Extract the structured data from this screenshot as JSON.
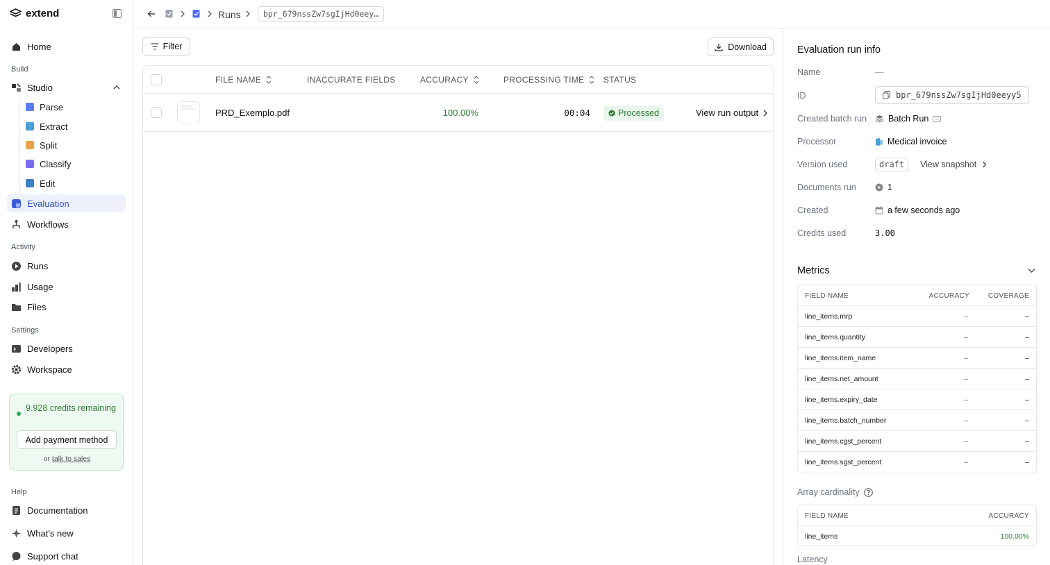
{
  "app": {
    "name": "extend"
  },
  "sidebar": {
    "home": "Home",
    "build_label": "Build",
    "studio": "Studio",
    "studio_items": [
      "Parse",
      "Extract",
      "Split",
      "Classify",
      "Edit"
    ],
    "evaluation": "Evaluation",
    "workflows": "Workflows",
    "activity_label": "Activity",
    "runs": "Runs",
    "usage": "Usage",
    "files": "Files",
    "settings_label": "Settings",
    "developers": "Developers",
    "workspace": "Workspace",
    "credits": "9.928 credits remaining",
    "add_payment": "Add payment method",
    "or": "or",
    "talk_to_sales": "talk to sales",
    "help_label": "Help",
    "documentation": "Documentation",
    "whats_new": "What's new",
    "support_chat": "Support chat"
  },
  "breadcrumb": {
    "runs": "Runs",
    "run_id": "bpr_679nssZw7sgIjHd0eey…"
  },
  "toolbar": {
    "filter": "Filter",
    "download": "Download"
  },
  "table": {
    "headers": {
      "file_name": "FILE NAME",
      "inaccurate_fields": "INACCURATE FIELDS",
      "accuracy": "ACCURACY",
      "processing_time": "PROCESSING TIME",
      "status": "STATUS"
    },
    "rows": [
      {
        "file_name": "PRD_Exemplo.pdf",
        "accuracy": "100.00%",
        "processing_time": "00:04",
        "status": "Processed",
        "action": "View run output"
      }
    ]
  },
  "run_info": {
    "title": "Evaluation run info",
    "labels": {
      "name": "Name",
      "id": "ID",
      "created_batch_run": "Created batch run",
      "processor": "Processor",
      "version_used": "Version used",
      "documents_run": "Documents run",
      "created": "Created",
      "credits_used": "Credits used"
    },
    "values": {
      "name": "—",
      "id": "bpr_679nssZw7sgIjHd0eeyy5",
      "created_batch_run": "Batch Run",
      "processor": "Medical invoice",
      "version": "draft",
      "view_snapshot": "View snapshot",
      "documents_run": "1",
      "created": "a few seconds ago",
      "credits_used": "3.00"
    }
  },
  "metrics": {
    "title": "Metrics",
    "headers": {
      "field_name": "FIELD NAME",
      "accuracy": "ACCURACY",
      "coverage": "COVERAGE"
    },
    "rows": [
      {
        "field": "line_items.mrp",
        "accuracy": "–",
        "coverage": "–"
      },
      {
        "field": "line_items.quantity",
        "accuracy": "–",
        "coverage": "–"
      },
      {
        "field": "line_items.item_name",
        "accuracy": "–",
        "coverage": "–"
      },
      {
        "field": "line_items.net_amount",
        "accuracy": "–",
        "coverage": "–"
      },
      {
        "field": "line_items.expiry_date",
        "accuracy": "–",
        "coverage": "–"
      },
      {
        "field": "line_items.batch_number",
        "accuracy": "–",
        "coverage": "–"
      },
      {
        "field": "line_items.cgst_percent",
        "accuracy": "–",
        "coverage": "–"
      },
      {
        "field": "line_items.sgst_percent",
        "accuracy": "–",
        "coverage": "–"
      }
    ]
  },
  "array_cardinality": {
    "title": "Array cardinality",
    "headers": {
      "field_name": "FIELD NAME",
      "accuracy": "ACCURACY"
    },
    "rows": [
      {
        "field": "line_items",
        "accuracy": "100.00%"
      }
    ]
  },
  "latency": {
    "title": "Latency"
  },
  "colors": {
    "accent": "#2f4fc7",
    "accent_bg": "#eef1fb",
    "success": "#2e7d32",
    "success_bg": "#eaf6ec",
    "border": "#e5e7eb"
  },
  "icons": {
    "logo": "extend-logo-icon",
    "collapse": "sidebar-collapse-icon",
    "back": "arrow-left-icon",
    "filter": "filter-icon",
    "download": "download-icon",
    "copy": "copy-icon",
    "help": "help-circle-icon",
    "chevron": "chevron-right-icon"
  }
}
